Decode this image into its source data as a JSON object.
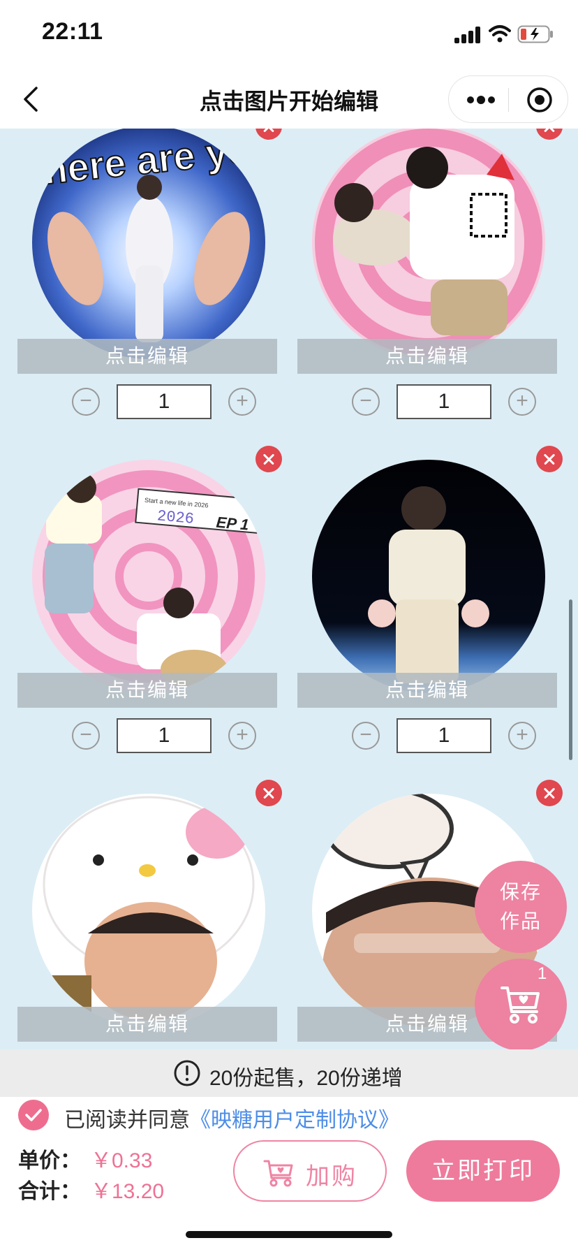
{
  "status_bar": {
    "time": "22:11"
  },
  "nav": {
    "title": "点击图片开始编辑"
  },
  "cards": [
    {
      "edit_label": "点击编辑",
      "quantity": "1",
      "minus": "−",
      "plus": "+"
    },
    {
      "edit_label": "点击编辑",
      "quantity": "1",
      "minus": "−",
      "plus": "+"
    },
    {
      "edit_label": "点击编辑",
      "quantity": "1",
      "minus": "−",
      "plus": "+"
    },
    {
      "edit_label": "点击编辑",
      "quantity": "1",
      "minus": "−",
      "plus": "+"
    },
    {
      "edit_label": "点击编辑"
    },
    {
      "edit_label": "点击编辑"
    }
  ],
  "photo_captions": {
    "card1_banner": "Where are you!",
    "card3_banner": "Start a new life in 2026",
    "card3_year": "2026",
    "card3_ep": "EP 1"
  },
  "fab": {
    "save_line1": "保存",
    "save_line2": "作品",
    "cart_count": "1"
  },
  "notice": {
    "text": "20份起售，20份递增"
  },
  "agreement": {
    "prefix": "已阅读并同意",
    "link": "《映糖用户定制协议》"
  },
  "price": {
    "unit_label": "单价：",
    "unit_value": "￥0.33",
    "total_label": "合计：",
    "total_value": "￥13.20"
  },
  "actions": {
    "add_label": "加购",
    "print_label": "立即打印"
  },
  "colors": {
    "accent": "#ee7b9c",
    "link": "#4d8de8",
    "delete": "#e0474e",
    "background": "#dcedf5"
  }
}
